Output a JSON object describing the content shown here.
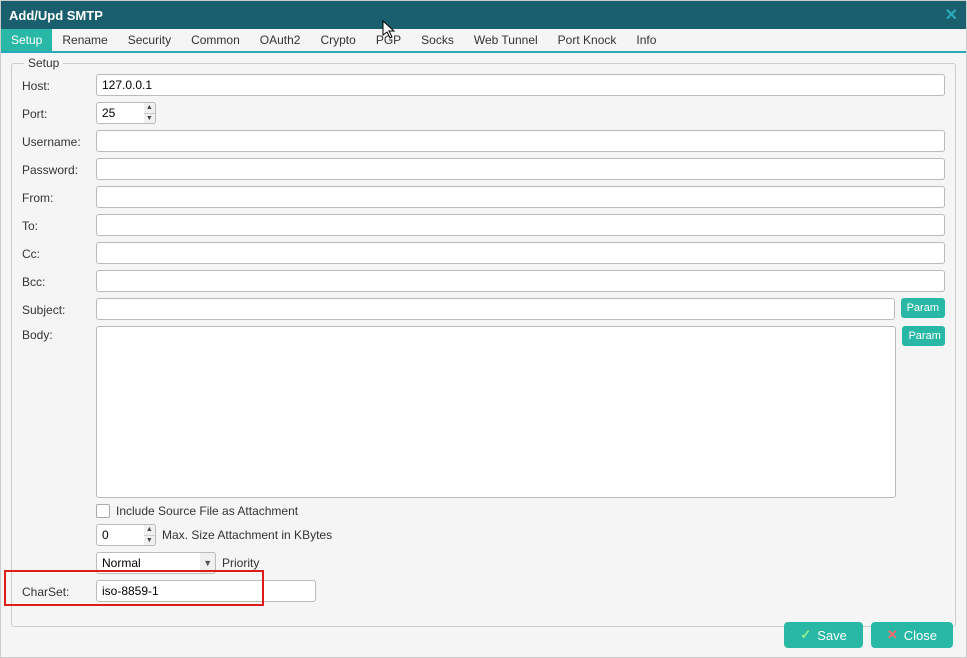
{
  "window": {
    "title": "Add/Upd SMTP"
  },
  "tabs": [
    "Setup",
    "Rename",
    "Security",
    "Common",
    "OAuth2",
    "Crypto",
    "PGP",
    "Socks",
    "Web Tunnel",
    "Port Knock",
    "Info"
  ],
  "active_tab_index": 0,
  "form": {
    "legend": "Setup",
    "labels": {
      "host": "Host:",
      "port": "Port:",
      "username": "Username:",
      "password": "Password:",
      "from": "From:",
      "to": "To:",
      "cc": "Cc:",
      "bcc": "Bcc:",
      "subject": "Subject:",
      "body": "Body:",
      "charset": "CharSet:"
    },
    "values": {
      "host": "127.0.0.1",
      "port": "25",
      "username": "",
      "password": "",
      "from": "",
      "to": "",
      "cc": "",
      "bcc": "",
      "subject": "",
      "body": "",
      "include_source": false,
      "max_size": "0",
      "priority": "Normal",
      "charset": "iso-8859-1"
    },
    "buttons": {
      "param": "Param",
      "save": "Save",
      "close": "Close"
    },
    "text": {
      "include_source": "Include Source File as Attachment",
      "max_size_suffix": "Max. Size Attachment in KBytes",
      "priority_suffix": "Priority"
    }
  }
}
